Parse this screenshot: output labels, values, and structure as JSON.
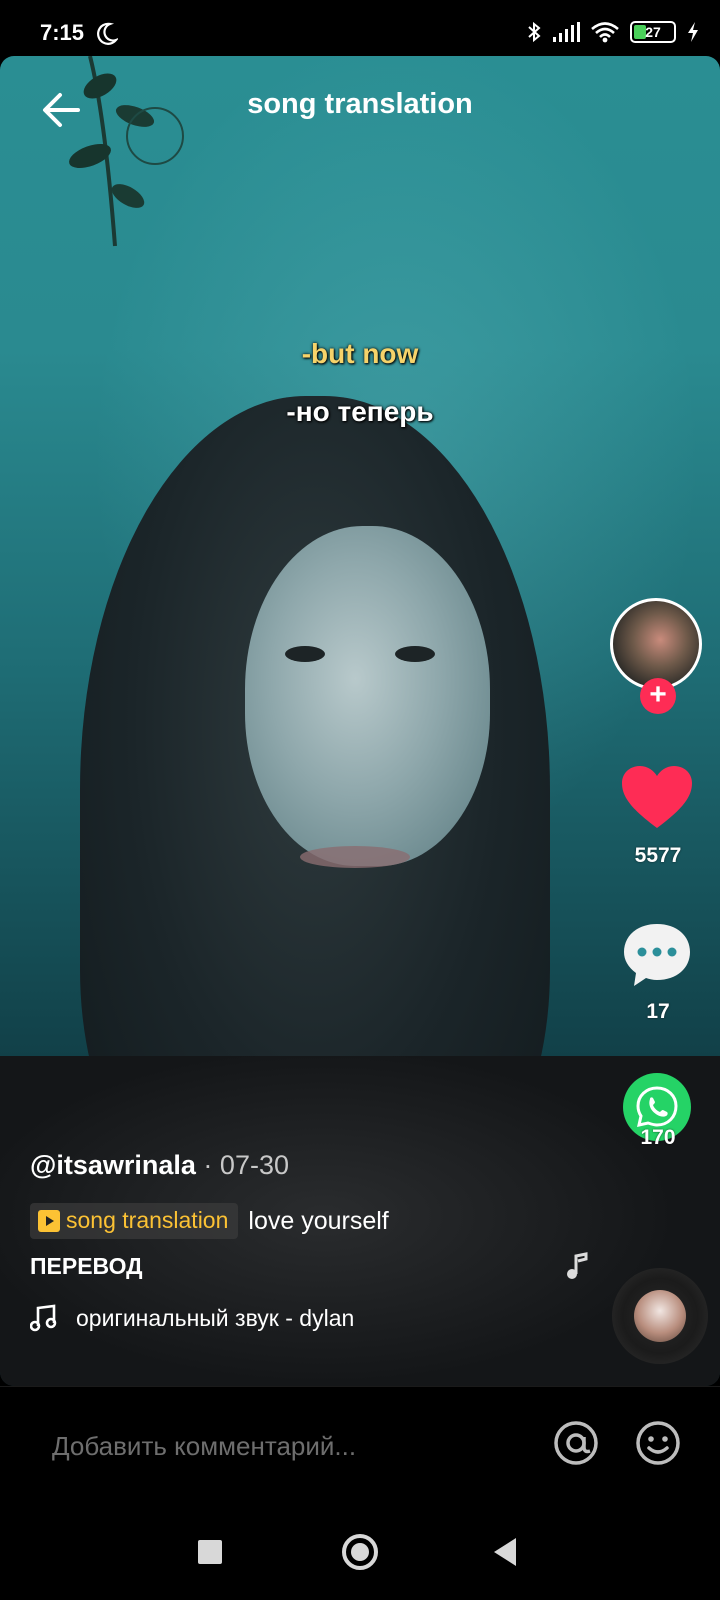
{
  "status_bar": {
    "time": "7:15",
    "battery": "27"
  },
  "header": {
    "title": "song translation"
  },
  "captions": {
    "english": "-but now",
    "russian": "-но теперь"
  },
  "actions": {
    "likes": "5577",
    "comments": "17",
    "shares": "170"
  },
  "post": {
    "username": "@itsawrinala",
    "separator": "·",
    "date": "07-30",
    "tag": "song translation",
    "description": "love yourself",
    "extra": "ПЕРЕВОД",
    "sound": "оригинальный звук - dylan"
  },
  "comment_bar": {
    "placeholder": "Добавить комментарий..."
  },
  "colors": {
    "like": "#fe2c55",
    "whatsapp": "#25d366",
    "tag": "#fcc234",
    "caption_en": "#f6d36a"
  },
  "icons": [
    "moon-icon",
    "bluetooth-icon",
    "signal-icon",
    "wifi-icon",
    "battery-icon",
    "charging-icon",
    "back-arrow-icon",
    "heart-icon",
    "comment-icon",
    "whatsapp-icon",
    "music-note-icon",
    "at-icon",
    "emoji-icon"
  ]
}
